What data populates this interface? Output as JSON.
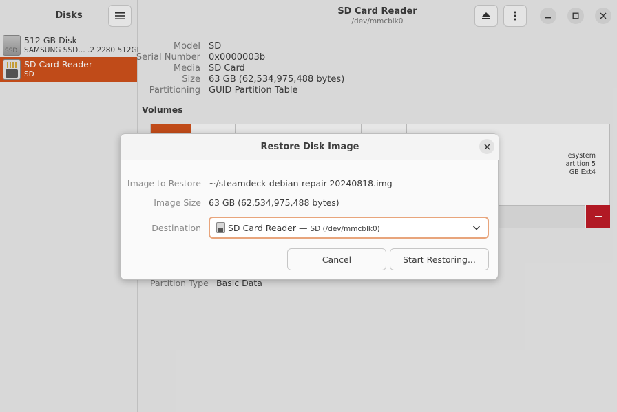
{
  "sidebar": {
    "title": "Disks",
    "disks": [
      {
        "name": "512 GB Disk",
        "sub": "SAMSUNG SSD… .2 2280 512GB",
        "icon": "ssd-drive-icon",
        "icon_label": "SSD"
      },
      {
        "name": "SD Card Reader",
        "sub": "SD",
        "icon": "sd-card-icon",
        "selected": true
      }
    ]
  },
  "header": {
    "title": "SD Card Reader",
    "subtitle": "/dev/mmcblk0"
  },
  "details": {
    "model_label": "Model",
    "model": "SD",
    "serial_label": "Serial Number",
    "serial": "0x0000003b",
    "media_label": "Media",
    "media": "SD Card",
    "size_label": "Size",
    "size": "63 GB (62,534,975,488 bytes)",
    "partitioning_label": "Partitioning",
    "partitioning": "GUID Partition Table",
    "volumes_label": "Volumes",
    "vol_text_1": "esystem",
    "vol_text_2": "artition 5",
    "vol_text_3": "GB Ext4",
    "partition_type_label": "Partition Type",
    "partition_type": "Basic Data"
  },
  "dialog": {
    "title": "Restore Disk Image",
    "image_label": "Image to Restore",
    "image_value": "~/steamdeck-debian-repair-20240818.img",
    "size_label": "Image Size",
    "size_value": "63 GB (62,534,975,488 bytes)",
    "destination_label": "Destination",
    "destination_name": "SD Card Reader —",
    "destination_detail": "SD (/dev/mmcblk0)",
    "cancel": "Cancel",
    "start": "Start Restoring..."
  },
  "colors": {
    "accent": "#d1521c",
    "danger": "#c01c28",
    "focus": "#e8a57c"
  }
}
